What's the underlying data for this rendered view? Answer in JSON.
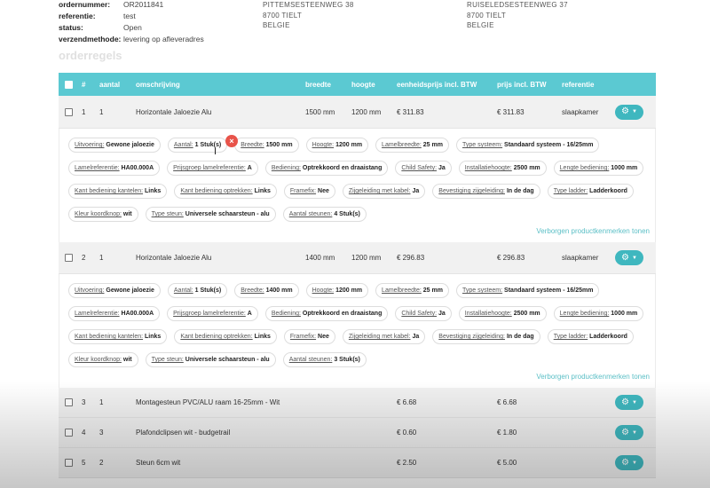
{
  "order": {
    "fields": [
      {
        "label": "ordernummer:",
        "value": "OR2011841"
      },
      {
        "label": "referentie:",
        "value": "test"
      },
      {
        "label": "status:",
        "value": "Open"
      },
      {
        "label": "verzendmethode:",
        "value": "levering op afleveradres"
      }
    ],
    "address_billing": [
      "PITTEMSESTEENWEG 38",
      "8700 TIELT",
      "BELGIE"
    ],
    "address_delivery": [
      "RUISELEDSESTEENWEG 37",
      "8700 TIELT",
      "BELGIE"
    ]
  },
  "section_title": "orderregels",
  "table": {
    "headers": {
      "num": "#",
      "aantal": "aantal",
      "omschrijving": "omschrijving",
      "breedte": "breedte",
      "hoogte": "hoogte",
      "eenheidsprijs": "eenheidsprijs incl. BTW",
      "prijs": "prijs incl. BTW",
      "referentie": "referentie"
    },
    "rows": [
      {
        "num": "1",
        "aantal": "1",
        "omschrijving": "Horizontale Jaloezie Alu",
        "breedte": "1500 mm",
        "hoogte": "1200 mm",
        "eenheidsprijs": "€ 311.83",
        "prijs": "€ 311.83",
        "referentie": "slaapkamer"
      },
      {
        "num": "2",
        "aantal": "1",
        "omschrijving": "Horizontale Jaloezie Alu",
        "breedte": "1400 mm",
        "hoogte": "1200 mm",
        "eenheidsprijs": "€ 296.83",
        "prijs": "€ 296.83",
        "referentie": "slaapkamer"
      },
      {
        "num": "3",
        "aantal": "1",
        "omschrijving": "Montagesteun PVC/ALU raam 16-25mm - Wit",
        "breedte": "",
        "hoogte": "",
        "eenheidsprijs": "€ 6.68",
        "prijs": "€ 6.68",
        "referentie": ""
      },
      {
        "num": "4",
        "aantal": "3",
        "omschrijving": "Plafondclipsen wit - budgetrail",
        "breedte": "",
        "hoogte": "",
        "eenheidsprijs": "€ 0.60",
        "prijs": "€ 1.80",
        "referentie": ""
      },
      {
        "num": "5",
        "aantal": "2",
        "omschrijving": "Steun 6cm wit",
        "breedte": "",
        "hoogte": "",
        "eenheidsprijs": "€ 2.50",
        "prijs": "€ 5.00",
        "referentie": ""
      }
    ]
  },
  "details": [
    {
      "chips": [
        {
          "k": "Uitvoering:",
          "v": "Gewone jaloezie"
        },
        {
          "k": "Aantal:",
          "v": "1 Stuk(s)"
        },
        {
          "k": "Breedte:",
          "v": "1500 mm"
        },
        {
          "k": "Hoogte:",
          "v": "1200 mm"
        },
        {
          "k": "Lamelbreedte:",
          "v": "25 mm"
        },
        {
          "k": "Type systeem:",
          "v": "Standaard systeem - 16/25mm"
        },
        {
          "k": "Lamelreferentie:",
          "v": "HA00.000A"
        },
        {
          "k": "Prijsgroep lamelreferentie:",
          "v": "A"
        },
        {
          "k": "Bediening:",
          "v": "Optrekkoord en draaistang"
        },
        {
          "k": "Child Safety:",
          "v": "Ja"
        },
        {
          "k": "Installatiehoogte:",
          "v": "2500 mm"
        },
        {
          "k": "Lengte bediening:",
          "v": "1000 mm"
        },
        {
          "k": "Kant bediening kantelen:",
          "v": "Links"
        },
        {
          "k": "Kant bediening optrekken:",
          "v": "Links"
        },
        {
          "k": "Framefix:",
          "v": "Nee"
        },
        {
          "k": "Zijgeleiding met kabel:",
          "v": "Ja"
        },
        {
          "k": "Bevestiging zijgeleiding:",
          "v": "In de dag"
        },
        {
          "k": "Type ladder:",
          "v": "Ladderkoord"
        },
        {
          "k": "Kleur koordknop:",
          "v": "wit"
        },
        {
          "k": "Type steun:",
          "v": "Universele schaarsteun - alu"
        },
        {
          "k": "Aantal steunen:",
          "v": "4 Stuk(s)"
        }
      ],
      "link": "Verborgen productkenmerken tonen"
    },
    {
      "chips": [
        {
          "k": "Uitvoering:",
          "v": "Gewone jaloezie"
        },
        {
          "k": "Aantal:",
          "v": "1 Stuk(s)"
        },
        {
          "k": "Breedte:",
          "v": "1400 mm"
        },
        {
          "k": "Hoogte:",
          "v": "1200 mm"
        },
        {
          "k": "Lamelbreedte:",
          "v": "25 mm"
        },
        {
          "k": "Type systeem:",
          "v": "Standaard systeem - 16/25mm"
        },
        {
          "k": "Lamelreferentie:",
          "v": "HA00.000A"
        },
        {
          "k": "Prijsgroep lamelreferentie:",
          "v": "A"
        },
        {
          "k": "Bediening:",
          "v": "Optrekkoord en draaistang"
        },
        {
          "k": "Child Safety:",
          "v": "Ja"
        },
        {
          "k": "Installatiehoogte:",
          "v": "2500 mm"
        },
        {
          "k": "Lengte bediening:",
          "v": "1000 mm"
        },
        {
          "k": "Kant bediening kantelen:",
          "v": "Links"
        },
        {
          "k": "Kant bediening optrekken:",
          "v": "Links"
        },
        {
          "k": "Framefix:",
          "v": "Nee"
        },
        {
          "k": "Zijgeleiding met kabel:",
          "v": "Ja"
        },
        {
          "k": "Bevestiging zijgeleiding:",
          "v": "In de dag"
        },
        {
          "k": "Type ladder:",
          "v": "Ladderkoord"
        },
        {
          "k": "Kleur koordknop:",
          "v": "wit"
        },
        {
          "k": "Type steun:",
          "v": "Universele schaarsteun - alu"
        },
        {
          "k": "Aantal steunen:",
          "v": "3 Stuk(s)"
        }
      ],
      "link": "Verborgen productkenmerken tonen"
    }
  ],
  "icons": {
    "gear": "gear-icon",
    "chevron": "chevron-down-icon",
    "close": "close-icon",
    "cursor": "text-cursor-icon"
  },
  "colors": {
    "accent": "#5bc9d2",
    "button": "#3fb7bf",
    "close": "#e8534a",
    "row_bg": "#f1f1f1"
  }
}
